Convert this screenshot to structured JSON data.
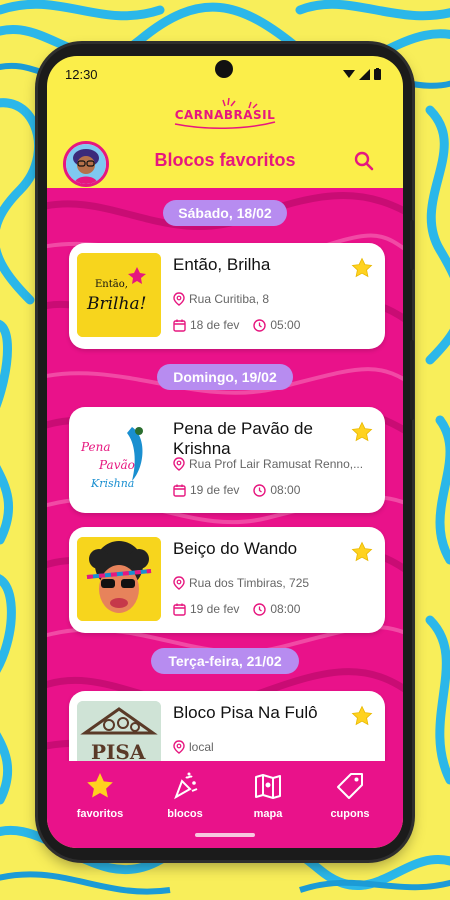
{
  "status": {
    "time": "12:30"
  },
  "app": {
    "logo_text": "CARNABRASIL"
  },
  "header": {
    "title": "Blocos favoritos"
  },
  "groups": [
    {
      "date_label": "Sábado, 18/02",
      "cards": [
        {
          "title": "Então, Brilha",
          "address": "Rua Curitiba, 8",
          "date": "18 de fev",
          "time": "05:00",
          "thumb_text_1": "Então,",
          "thumb_text_2": "Brilha!"
        }
      ]
    },
    {
      "date_label": "Domingo, 19/02",
      "cards": [
        {
          "title": "Pena de Pavão de Krishna",
          "address": "Rua Prof Lair Ramusat Renno,...",
          "date": "19 de fev",
          "time": "08:00",
          "thumb_text_1": "Pena",
          "thumb_text_2": "Pavão",
          "thumb_text_3": "Krishna"
        },
        {
          "title": "Beiço do Wando",
          "address": "Rua dos Timbiras, 725",
          "date": "19 de fev",
          "time": "08:00"
        }
      ]
    },
    {
      "date_label": "Terça-feira, 21/02",
      "cards": [
        {
          "title": "Bloco Pisa Na Fulô",
          "address": "local",
          "thumb_text_1": "PISA"
        }
      ]
    }
  ],
  "nav": [
    {
      "label": "favoritos",
      "icon": "star-icon",
      "active": true
    },
    {
      "label": "blocos",
      "icon": "confetti-icon",
      "active": false
    },
    {
      "label": "mapa",
      "icon": "map-icon",
      "active": false
    },
    {
      "label": "cupons",
      "icon": "coupon-icon",
      "active": false
    }
  ],
  "colors": {
    "brand_pink": "#e9128a",
    "brand_yellow": "#fbee4a",
    "pill_purple": "#b78cf0",
    "star_yellow": "#ffd21f"
  }
}
